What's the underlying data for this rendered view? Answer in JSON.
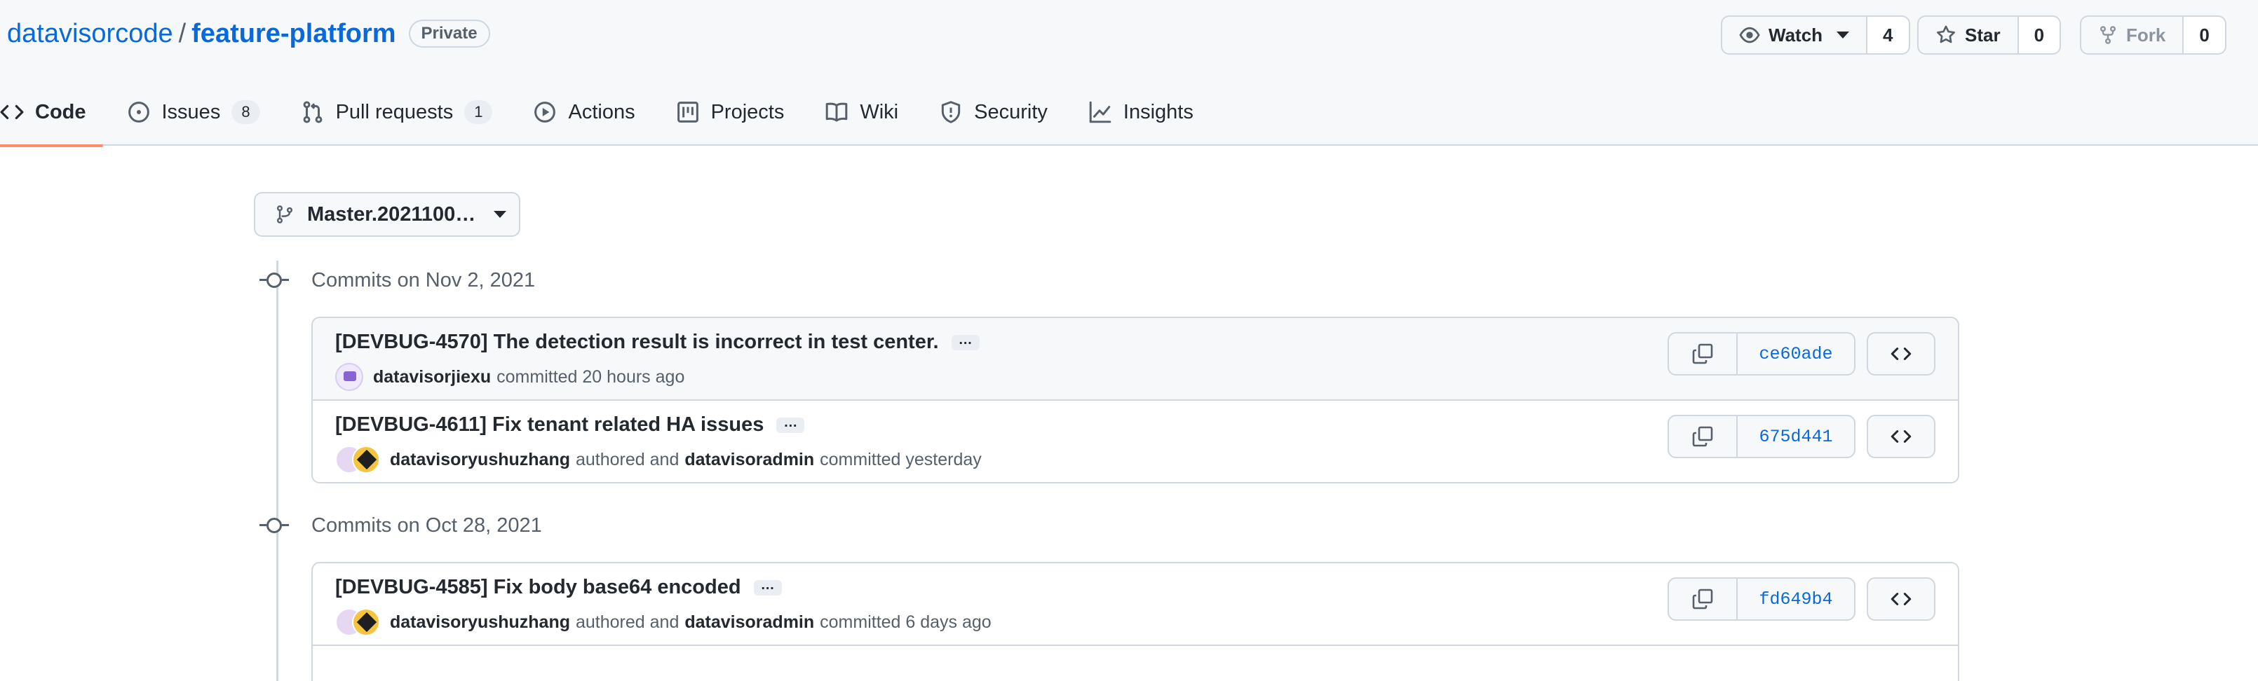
{
  "repo": {
    "owner": "datavisorcode",
    "separator": "/",
    "name": "feature-platform",
    "visibility": "Private"
  },
  "actions": {
    "watch": {
      "label": "Watch",
      "count": "4"
    },
    "star": {
      "label": "Star",
      "count": "0"
    },
    "fork": {
      "label": "Fork",
      "count": "0"
    }
  },
  "tabs": [
    {
      "label": "Code",
      "icon": "code-icon",
      "active": true
    },
    {
      "label": "Issues",
      "icon": "issue-opened-icon",
      "count": "8"
    },
    {
      "label": "Pull requests",
      "icon": "git-pull-request-icon",
      "count": "1"
    },
    {
      "label": "Actions",
      "icon": "play-icon"
    },
    {
      "label": "Projects",
      "icon": "project-icon"
    },
    {
      "label": "Wiki",
      "icon": "book-icon"
    },
    {
      "label": "Security",
      "icon": "shield-icon"
    },
    {
      "label": "Insights",
      "icon": "graph-icon"
    }
  ],
  "branch": {
    "label": "Master.2021100…",
    "icon": "git-branch-icon"
  },
  "commit_groups": [
    {
      "date_label": "Commits on Nov 2, 2021",
      "commits": [
        {
          "message": "[DEVBUG-4570] The detection result is incorrect in test center.",
          "author": "datavisorjiexu",
          "mid_text": "",
          "committer": "",
          "action": "committed 20 hours ago",
          "sha": "ce60ade"
        },
        {
          "message": "[DEVBUG-4611] Fix tenant related HA issues",
          "author": "datavisoryushuzhang",
          "mid_text": "authored and",
          "committer": "datavisoradmin",
          "action": "committed yesterday",
          "sha": "675d441"
        }
      ]
    },
    {
      "date_label": "Commits on Oct 28, 2021",
      "commits": [
        {
          "message": "[DEVBUG-4585] Fix body base64 encoded",
          "author": "datavisoryushuzhang",
          "mid_text": "authored and",
          "committer": "datavisoradmin",
          "action": "committed 6 days ago",
          "sha": "fd649b4"
        }
      ]
    }
  ],
  "ellipsis_label": "…",
  "browse_label": "<>",
  "colors": {
    "link": "#0969da",
    "active_tab_underline": "#fd8c73",
    "header_bg": "#f6f8fa",
    "border": "#d0d7de"
  }
}
